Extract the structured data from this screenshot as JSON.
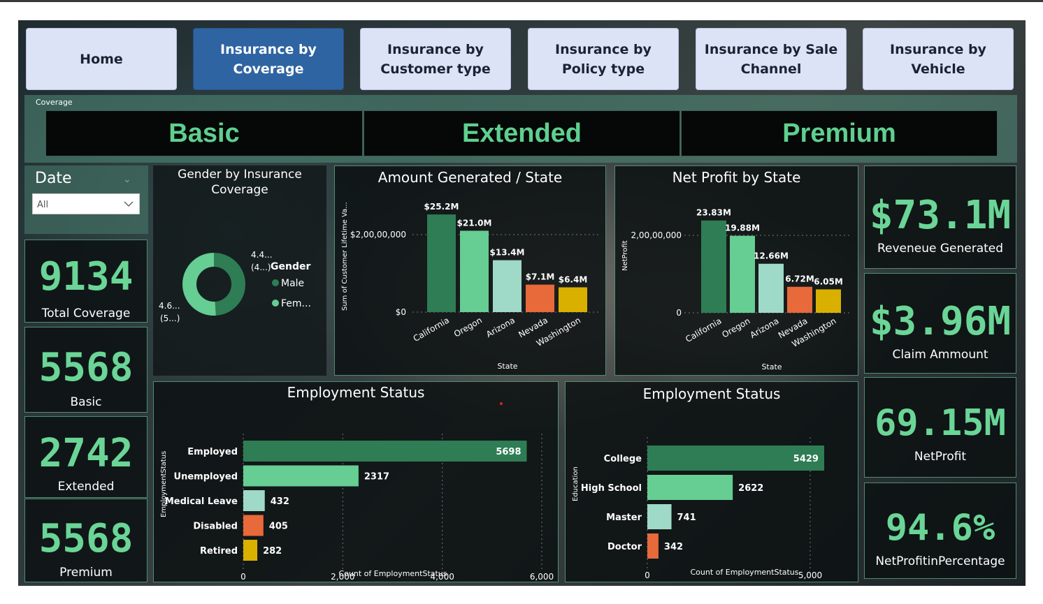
{
  "nav": {
    "home": "Home",
    "coverage": "Insurance by Coverage",
    "customer_type": "Insurance by Customer type",
    "policy_type": "Insurance by Policy type",
    "sale_channel": "Insurance by Sale Channel",
    "vehicle": "Insurance by Vehicle"
  },
  "coverage_slicer": {
    "title": "Coverage",
    "options": [
      "Basic",
      "Extended",
      "Premium"
    ]
  },
  "date_filter": {
    "label": "Date",
    "value": "All",
    "icon": "chevron-down-icon"
  },
  "kpis_left": [
    {
      "value": "9134",
      "label": "Total Coverage"
    },
    {
      "value": "5568",
      "label": "Basic"
    },
    {
      "value": "2742",
      "label": "Extended"
    },
    {
      "value": "5568",
      "label": "Premium"
    }
  ],
  "kpis_right": [
    {
      "value": "$73.1M",
      "label": "Reveneue Generated"
    },
    {
      "value": "$3.96M",
      "label": "Claim Ammount"
    },
    {
      "value": "69.15M",
      "label": "NetProfit"
    },
    {
      "value": "94.6%",
      "label": "NetProfitinPercentage"
    }
  ],
  "colors": {
    "dark_green": "#2e7d54",
    "light_green": "#66cd93",
    "pale_teal": "#9fd9c8",
    "orange": "#e8693a",
    "gold": "#d9b000",
    "text_green": "#6ad596"
  },
  "chart_data": [
    {
      "type": "pie",
      "title": "Gender by Insurance Coverage",
      "legend_title": "Gender",
      "legend_position": "right",
      "categories": [
        "Male",
        "Fem..."
      ],
      "values": [
        4.4,
        4.6
      ],
      "slice_labels": [
        "4.4...",
        "(4...)",
        "4.6...",
        "(5...)"
      ]
    },
    {
      "type": "bar",
      "title": "Amount Generated / State",
      "xlabel": "State",
      "ylabel": "Sum of Customer Lifetime Va...",
      "yticks": [
        "$0",
        "$2,00,00,000"
      ],
      "categories": [
        "California",
        "Oregon",
        "Arizona",
        "Nevada",
        "Washington"
      ],
      "values": [
        25.2,
        21.0,
        13.4,
        7.1,
        6.4
      ],
      "value_labels": [
        "$25.2M",
        "$21.0M",
        "$13.4M",
        "$7.1M",
        "$6.4M"
      ],
      "unit": "M"
    },
    {
      "type": "bar",
      "title": "Net Profit by State",
      "xlabel": "State",
      "ylabel": "NetProfit",
      "yticks": [
        "0",
        "2,00,00,000"
      ],
      "categories": [
        "California",
        "Oregon",
        "Arizona",
        "Nevada",
        "Washington"
      ],
      "values": [
        23.83,
        19.88,
        12.66,
        6.72,
        6.05
      ],
      "value_labels": [
        "23.83M",
        "19.88M",
        "12.66M",
        "6.72M",
        "6.05M"
      ],
      "unit": "M"
    },
    {
      "type": "bar",
      "orientation": "horizontal",
      "title": "Employment Status",
      "xlabel": "Count of EmploymentStatus",
      "ylabel": "EmploymentStatus",
      "xticks": [
        "0",
        "2,000",
        "4,000",
        "6,000"
      ],
      "categories": [
        "Employed",
        "Unemployed",
        "Medical Leave",
        "Disabled",
        "Retired"
      ],
      "values": [
        5698,
        2317,
        432,
        405,
        282
      ]
    },
    {
      "type": "bar",
      "orientation": "horizontal",
      "title": "Employment Status",
      "xlabel": "Count of EmploymentStatus",
      "ylabel": "Education",
      "xticks": [
        "0",
        "5,000"
      ],
      "categories": [
        "College",
        "High School",
        "Master",
        "Doctor"
      ],
      "values": [
        5429,
        2622,
        741,
        342
      ]
    }
  ]
}
